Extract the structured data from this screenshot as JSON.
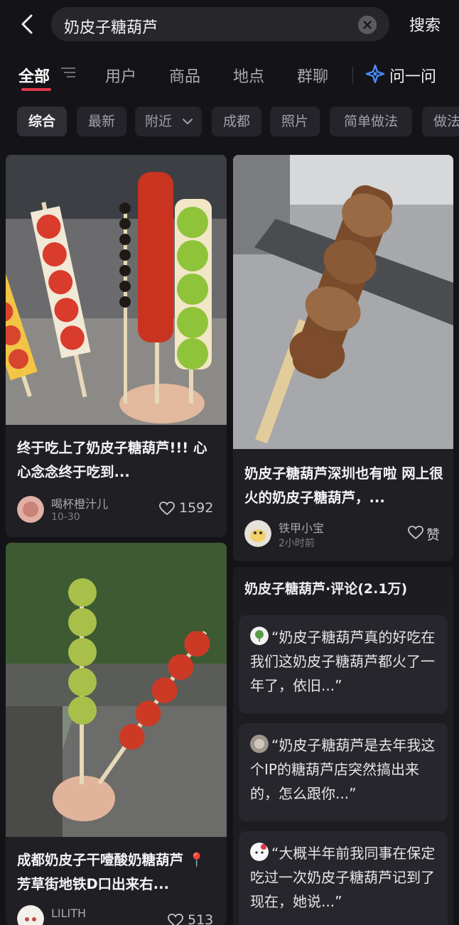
{
  "search": {
    "query": "奶皮子糖葫芦",
    "submit_label": "搜索"
  },
  "tabs": [
    {
      "label": "全部",
      "active": true
    },
    {
      "label": "用户"
    },
    {
      "label": "商品"
    },
    {
      "label": "地点"
    },
    {
      "label": "群聊"
    }
  ],
  "ask_label": "问一问",
  "filters": [
    "综合",
    "最新",
    "附近",
    "成都",
    "照片",
    "简单做法",
    "做法"
  ],
  "feed": [
    {
      "title": "终于吃上了奶皮子糖葫芦!!! 心心念念终于吃到...",
      "author": "喝杯橙汁儿",
      "time": "10-30",
      "likes": "1592"
    },
    {
      "title": "奶皮子糖葫芦深圳也有啦 网上很火的奶皮子糖葫芦，...",
      "author": "铁甲小宝",
      "time": "2小时前",
      "likes": "赞"
    },
    {
      "title": "成都奶皮子干噎酸奶糖葫芦 📍芳草街地铁D口出来右...",
      "author": "LILITH",
      "likes": "513"
    }
  ],
  "comments_panel": {
    "title": "奶皮子糖葫芦·评论(2.1万)",
    "items": [
      "“奶皮子糖葫芦真的好吃在我们这奶皮子糖葫芦都火了一年了，依旧...”",
      "“奶皮子糖葫芦是去年我这个IP的糖葫芦店突然搞出来的，怎么跟你...”",
      "“大概半年前我同事在保定吃过一次奶皮子糖葫芦记到了现在，她说...”"
    ]
  },
  "colors": {
    "background": "#141418",
    "card": "#1f1f24",
    "accent": "#e4364a",
    "ask_icon": "#4a8cff"
  }
}
